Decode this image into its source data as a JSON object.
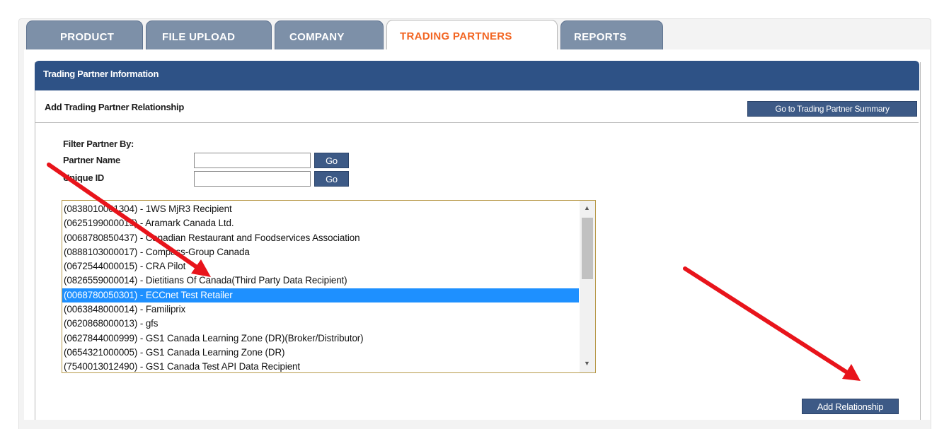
{
  "tabs": [
    {
      "label": "PRODUCT",
      "active": false
    },
    {
      "label": "FILE UPLOAD",
      "active": false
    },
    {
      "label": "COMPANY",
      "active": false
    },
    {
      "label": "TRADING PARTNERS",
      "active": true
    },
    {
      "label": "REPORTS",
      "active": false
    }
  ],
  "section": {
    "title": "Trading Partner Information",
    "subtitle": "Add Trading Partner Relationship",
    "summary_button": "Go to Trading Partner Summary"
  },
  "filter": {
    "heading": "Filter Partner By:",
    "partner_name_label": "Partner Name",
    "partner_name_value": "",
    "unique_id_label": "Unique ID",
    "unique_id_value": "",
    "go_label": "Go"
  },
  "partners": [
    "(0838010001304) - 1WS MjR3 Recipient",
    "(0625199000015) - Aramark Canada Ltd.",
    "(0068780850437) - Canadian Restaurant and Foodservices Association",
    "(0888103000017) - Compass-Group Canada",
    "(0672544000015) - CRA Pilot",
    "(0826559000014) - Dietitians Of Canada(Third Party Data Recipient)",
    "(0068780050301) - ECCnet Test Retailer",
    "(0063848000014) - Familiprix",
    "(0620868000013) - gfs",
    "(0627844000999) - GS1 Canada Learning Zone (DR)(Broker/Distributor)",
    "(0654321000005) - GS1 Canada Learning Zone (DR)",
    "(7540013012490) - GS1 Canada Test API Data Recipient"
  ],
  "selected_partner_index": 6,
  "add_button": "Add Relationship",
  "colors": {
    "header_blue": "#2e5286",
    "tab_inactive": "#7d90a8",
    "tab_active_text": "#f26522",
    "selection": "#1e90ff",
    "annotation_arrow": "#e8141b"
  }
}
